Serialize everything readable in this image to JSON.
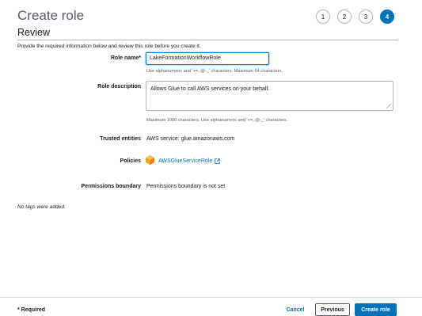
{
  "page": {
    "title": "Create role"
  },
  "steps": [
    "1",
    "2",
    "3",
    "4"
  ],
  "active_step": "4",
  "review": {
    "title": "Review",
    "intro": "Provide the required information below and review this role before you create it."
  },
  "form": {
    "role_name_label": "Role name*",
    "role_name_value": "LakeFormationWorkflowRole",
    "role_name_hint": "Use alphanumeric and '+=,.@-_' characters. Maximum 64 characters.",
    "role_description_label": "Role description",
    "role_description_value": "Allows Glue to call AWS services on your behalf.",
    "role_description_hint": "Maximum 1000 characters. Use alphanumeric and '+=,.@-_' characters.",
    "trusted_entities_label": "Trusted entities",
    "trusted_entities_value": "AWS service: glue.amazonaws.com",
    "policies_label": "Policies",
    "policy_name": "AWSGlueServiceRole",
    "permissions_boundary_label": "Permissions boundary",
    "permissions_boundary_value": "Permissions boundary is not set"
  },
  "tags_message": "No tags were added.",
  "footer": {
    "required_note": "* Required",
    "cancel_label": "Cancel",
    "previous_label": "Previous",
    "create_label": "Create role"
  },
  "colors": {
    "primary": "#0073bb",
    "policy_icon": "#f7a21b"
  },
  "icons": {
    "policy": "policy-cube-icon",
    "external_link": "external-link-icon"
  }
}
